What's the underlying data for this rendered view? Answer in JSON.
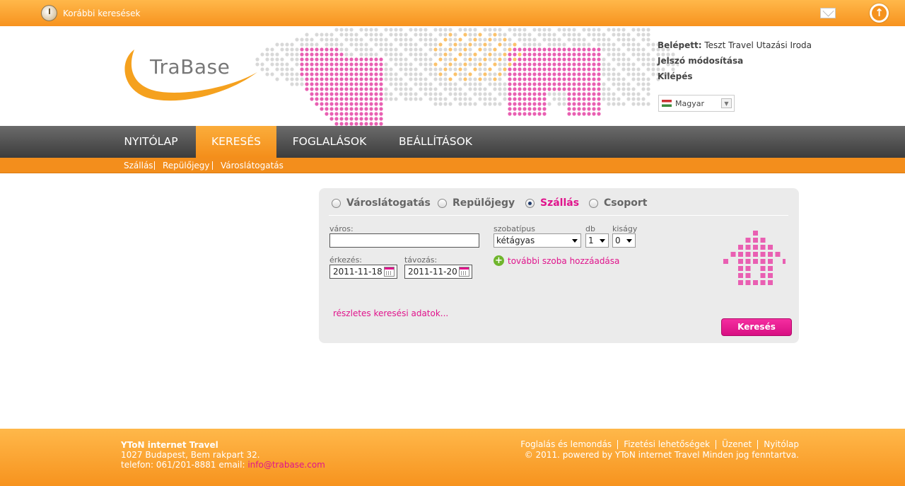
{
  "topbar": {
    "history_label": "Korábbi keresések",
    "icons": [
      "history-icon",
      "mail-icon",
      "scroll-up-icon"
    ]
  },
  "brand": {
    "name": "TraBase"
  },
  "user": {
    "logged_in_label": "Belépett:",
    "logged_in_value": "Teszt Travel Utazási Iroda",
    "change_password": "Jelszó módosítása",
    "logout": "Kilépés",
    "language": "Magyar"
  },
  "nav": {
    "items": [
      {
        "label": "NYITÓLAP",
        "active": false
      },
      {
        "label": "KERESÉS",
        "active": true
      },
      {
        "label": "FOGLALÁSOK",
        "active": false
      },
      {
        "label": "BEÁLLÍTÁSOK",
        "active": false
      }
    ],
    "sub": [
      "Szállás",
      "Repülőjegy",
      "Városlátogatás"
    ]
  },
  "search": {
    "types": [
      {
        "label": "Városlátogatás",
        "checked": false
      },
      {
        "label": "Repülőjegy",
        "checked": false
      },
      {
        "label": "Szállás",
        "checked": true
      },
      {
        "label": "Csoport",
        "checked": false
      }
    ],
    "city_label": "város:",
    "city_value": "",
    "arrival_label": "érkezés:",
    "arrival_value": "2011-11-18",
    "departure_label": "távozás:",
    "departure_value": "2011-11-20",
    "roomtype_label": "szobatípus",
    "roomtype_value": "kétágyas",
    "count_label": "db",
    "count_value": "1",
    "extra_bed_label": "kiságy",
    "extra_bed_value": "0",
    "add_room": "további szoba hozzáadása",
    "details": "részletes keresési adatok...",
    "submit": "Keresés"
  },
  "footer": {
    "company": "YToN internet Travel",
    "address": "1027 Budapest, Bem rakpart 32.",
    "phone_prefix": "telefon: 061/201-8881 email: ",
    "email": "info@trabase.com",
    "links": [
      "Foglalás és lemondás",
      "Fizetési lehetőségek",
      "Üzenet",
      "Nyitólap"
    ],
    "copyright": "© 2011. powered by YToN internet Travel Minden jog fenntartva."
  },
  "colors": {
    "orange": "#f7931e",
    "pink": "#e0148c",
    "dark": "#4a4a4a"
  }
}
